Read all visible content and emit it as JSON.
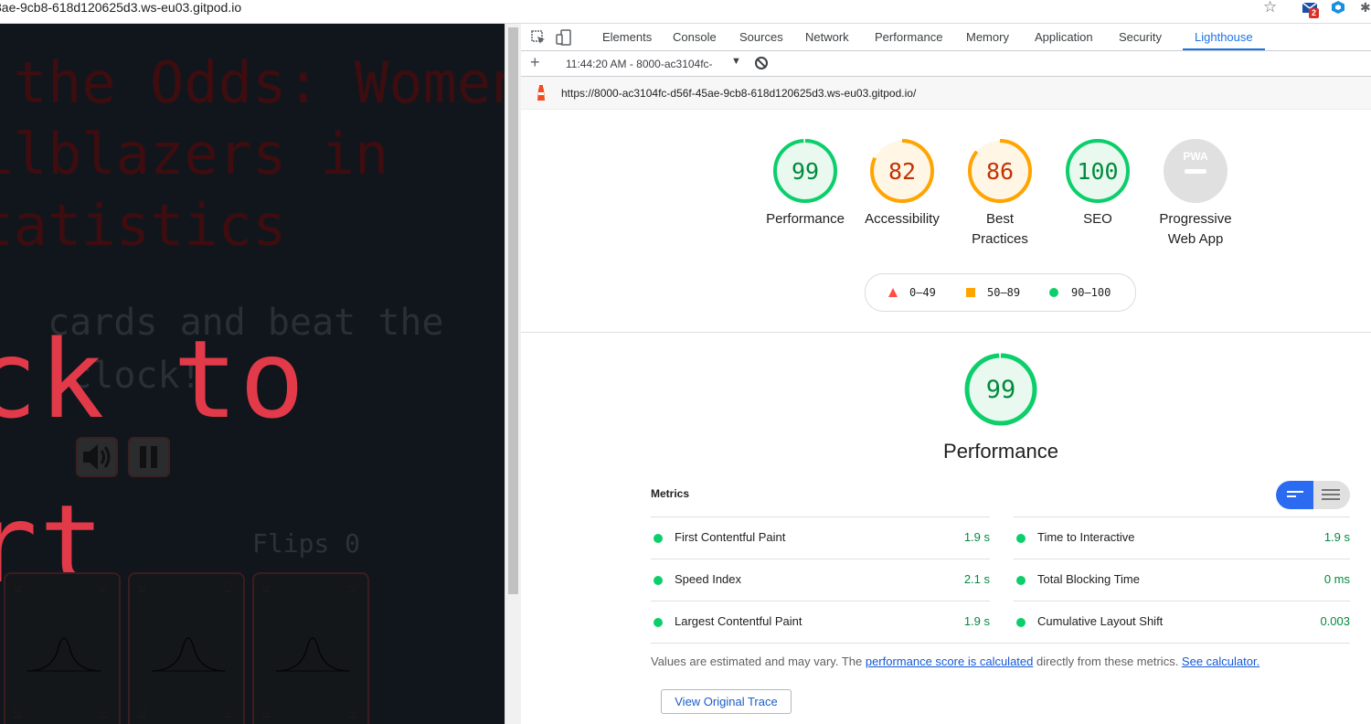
{
  "browser": {
    "url_fragment": "3ae-9cb8-618d120625d3.ws-eu03.gitpod.io",
    "mail_badge": "2"
  },
  "page": {
    "title_lines": [
      "l the Odds: Women",
      "ailblazers in",
      "Statistics"
    ],
    "subtitle_lines": [
      " cards and beat the",
      "  clock!"
    ],
    "big_line1": "ck to",
    "big_line2": "rt",
    "flips": "Flips 0"
  },
  "devtools": {
    "tabs": [
      "Elements",
      "Console",
      "Sources",
      "Network",
      "Performance",
      "Memory",
      "Application",
      "Security",
      "Lighthouse"
    ],
    "active_tab": "Lighthouse",
    "report_time": "11:44:20 AM - 8000-ac3104fc-",
    "report_url": "https://8000-ac3104fc-d56f-45ae-9cb8-618d120625d3.ws-eu03.gitpod.io/"
  },
  "scores": [
    {
      "label_1": "Performance",
      "label_2": "",
      "value": "99",
      "score": 99,
      "color": "#0cce6b",
      "fill": "#e9f9ef",
      "text": "#008a3e"
    },
    {
      "label_1": "Accessibility",
      "label_2": "",
      "value": "82",
      "score": 82,
      "color": "#ffa400",
      "fill": "#fff6e6",
      "text": "#c33300"
    },
    {
      "label_1": "Best",
      "label_2": "Practices",
      "value": "86",
      "score": 86,
      "color": "#ffa400",
      "fill": "#fff6e6",
      "text": "#c33300"
    },
    {
      "label_1": "SEO",
      "label_2": "",
      "value": "100",
      "score": 100,
      "color": "#0cce6b",
      "fill": "#e9f9ef",
      "text": "#008a3e"
    },
    {
      "label_1": "Progressive",
      "label_2": "Web App",
      "value": "PWA",
      "score": null,
      "color": "#d4d4d4",
      "fill": "#e0e0e0",
      "text": "#ffffff"
    }
  ],
  "legend": [
    {
      "range": "0–49",
      "color": "#ff4e42",
      "shape": "triangle"
    },
    {
      "range": "50–89",
      "color": "#ffa400",
      "shape": "square"
    },
    {
      "range": "90–100",
      "color": "#0cce6b",
      "shape": "circle"
    }
  ],
  "performance": {
    "score": "99",
    "title": "Performance",
    "metrics_heading": "Metrics",
    "metrics": [
      {
        "name": "First Contentful Paint",
        "value": "1.9 s"
      },
      {
        "name": "Time to Interactive",
        "value": "1.9 s"
      },
      {
        "name": "Speed Index",
        "value": "2.1 s"
      },
      {
        "name": "Total Blocking Time",
        "value": "0 ms"
      },
      {
        "name": "Largest Contentful Paint",
        "value": "1.9 s"
      },
      {
        "name": "Cumulative Layout Shift",
        "value": "0.003"
      }
    ],
    "note_prefix": "Values are estimated and may vary. The ",
    "note_link": "performance score is calculated",
    "note_mid": " directly from these metrics. ",
    "note_link2": "See calculator.",
    "trace_button": "View Original Trace"
  },
  "colors": {
    "good": "#0cce6b",
    "average": "#ffa400",
    "accent": "#1a73e8"
  }
}
